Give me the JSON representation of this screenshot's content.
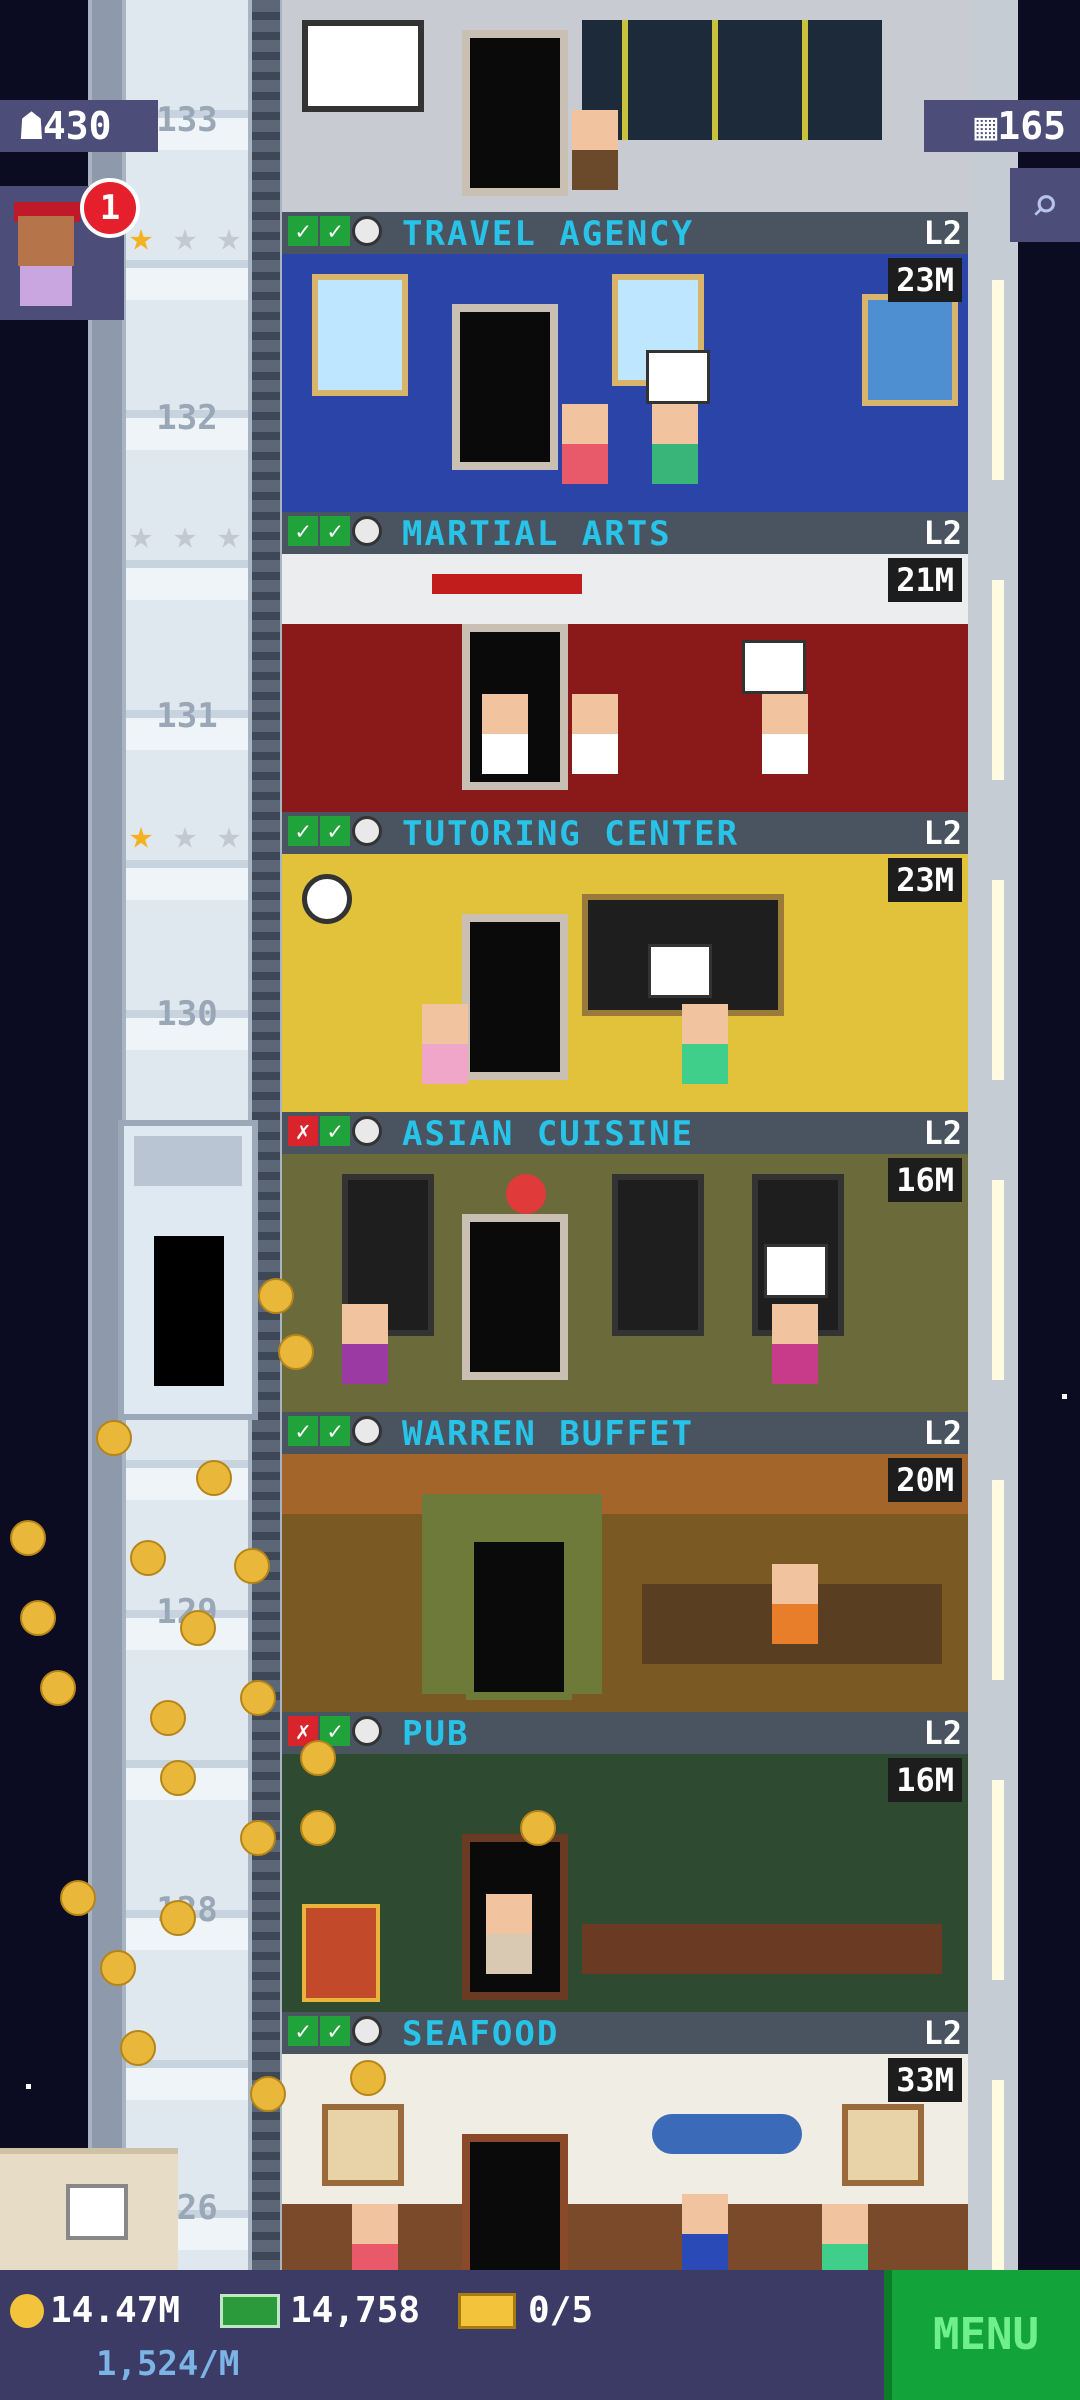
{
  "hud": {
    "population": "430",
    "floors_count": "165",
    "visitor_notification": "1",
    "coins": "14.47M",
    "bux": "14,758",
    "tickets": "0/5",
    "coin_rate": "1,524/M",
    "menu_label": "MENU"
  },
  "shaft": {
    "floor_numbers": [
      "133",
      "132",
      "131",
      "130",
      "129",
      "128",
      "127",
      "126"
    ]
  },
  "floors": [
    {
      "name": "TRAVEL AGENCY",
      "level": "L2",
      "income": "23M",
      "status": [
        "check",
        "check",
        "clock"
      ],
      "stars": [
        "gold",
        "grey",
        "grey"
      ],
      "color": "#2b44a8"
    },
    {
      "name": "MARTIAL ARTS",
      "level": "L2",
      "income": "21M",
      "status": [
        "check",
        "check",
        "clock"
      ],
      "stars": [
        "grey",
        "grey",
        "grey"
      ],
      "color": "#8a1a1a"
    },
    {
      "name": "TUTORING CENTER",
      "level": "L2",
      "income": "23M",
      "status": [
        "check",
        "check",
        "clock"
      ],
      "stars": [
        "gold",
        "grey",
        "grey"
      ],
      "color": "#e2c23a"
    },
    {
      "name": "ASIAN CUISINE",
      "level": "L2",
      "income": "16M",
      "status": [
        "x",
        "check",
        "clock"
      ],
      "stars": [],
      "color": "#6b6a3a"
    },
    {
      "name": "WARREN BUFFET",
      "level": "L2",
      "income": "20M",
      "status": [
        "check",
        "check",
        "clock"
      ],
      "stars": [],
      "color": "#7a5a22"
    },
    {
      "name": "PUB",
      "level": "L2",
      "income": "16M",
      "status": [
        "x",
        "check",
        "clock"
      ],
      "stars": [],
      "color": "#2e4a30"
    },
    {
      "name": "SEAFOOD",
      "level": "L2",
      "income": "33M",
      "status": [
        "check",
        "check",
        "clock"
      ],
      "stars": [],
      "color": "#f0ede4"
    }
  ],
  "icons": {
    "population": "person-icon",
    "floors": "building-icon",
    "search": "magnifier-icon",
    "coin": "coin-icon",
    "bux": "cash-icon",
    "ticket": "ticket-icon"
  }
}
